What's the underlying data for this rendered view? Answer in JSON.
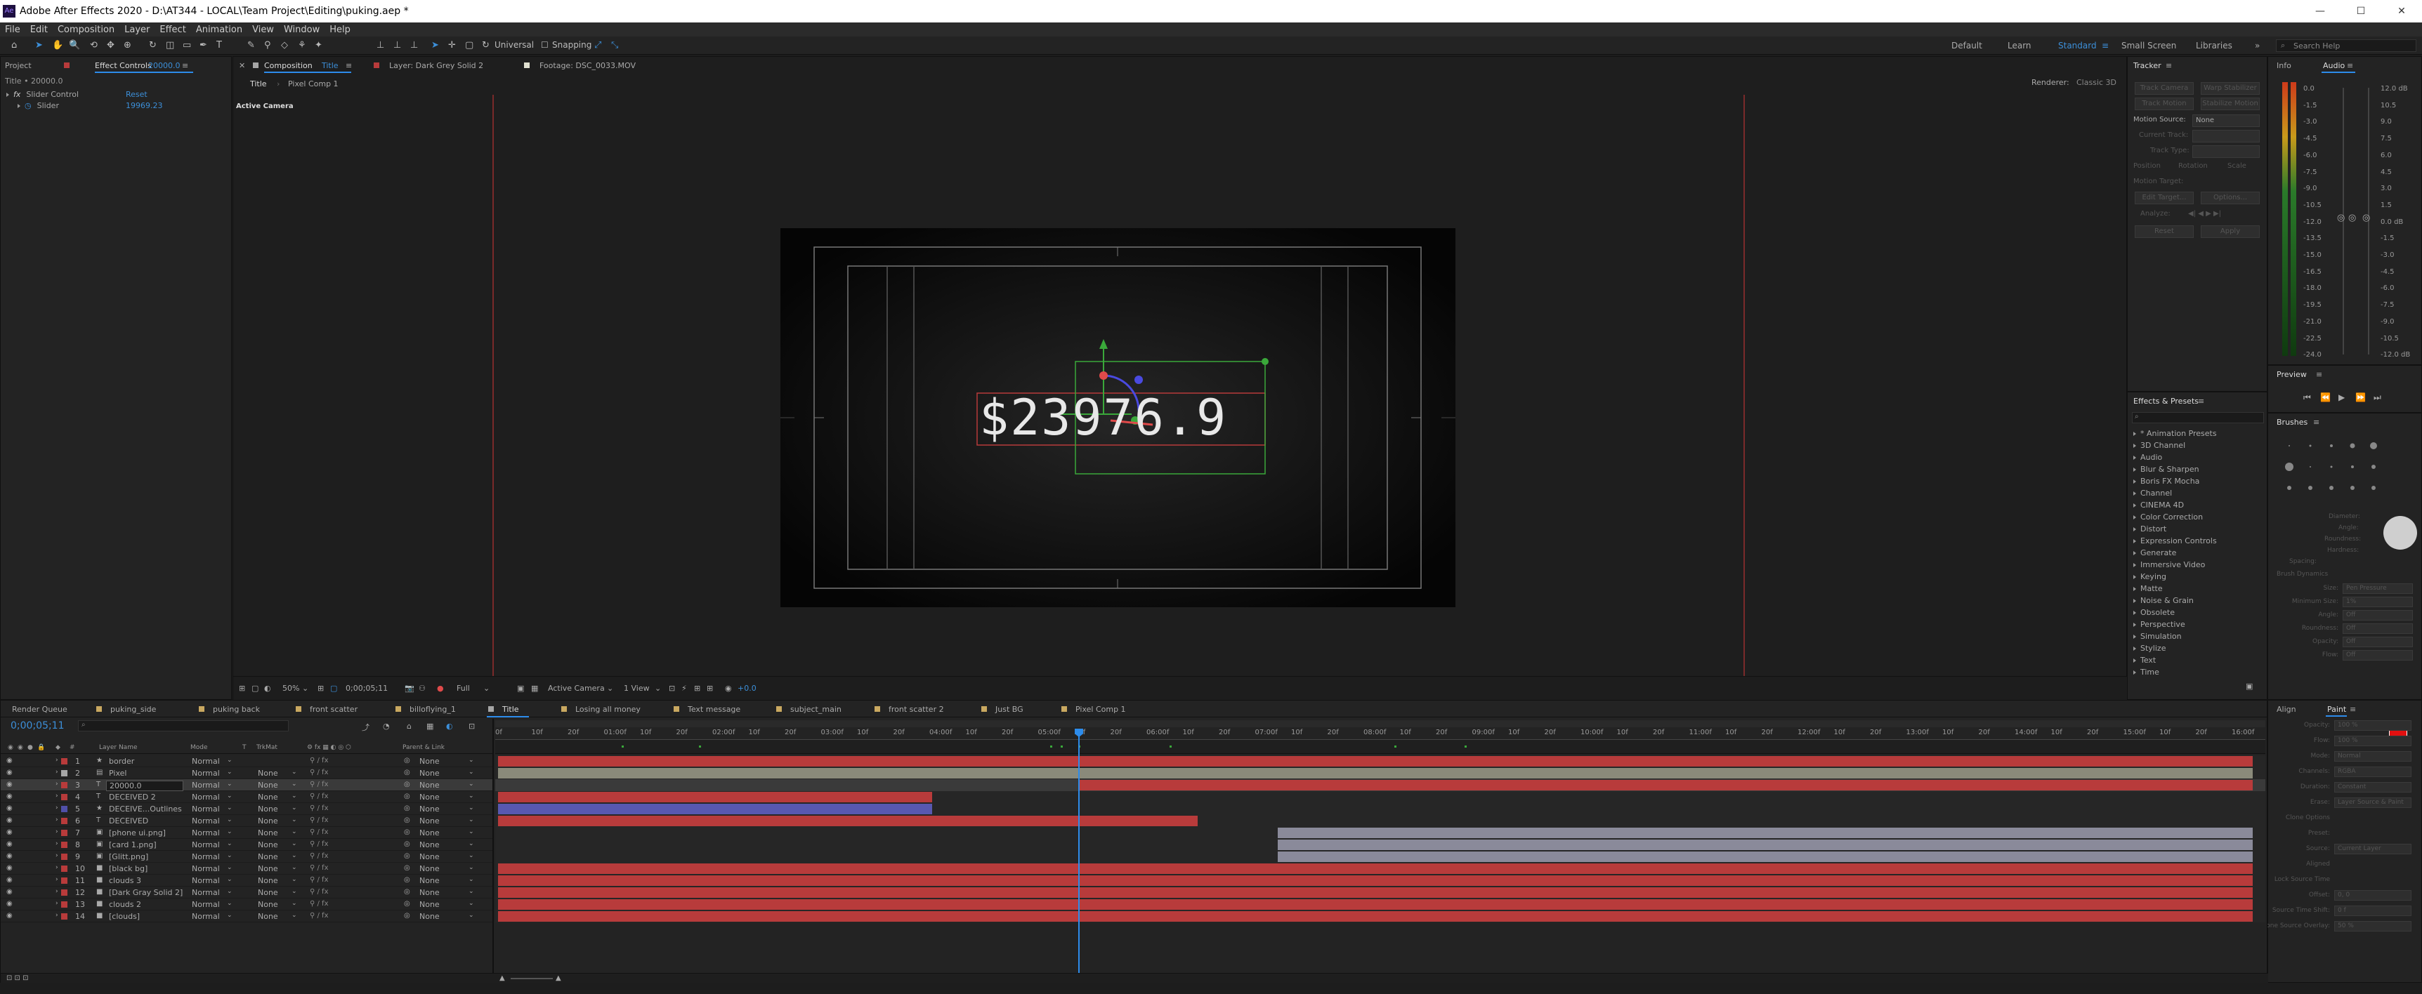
{
  "titlebar": {
    "title": "Adobe After Effects 2020 - D:\\AT344 - LOCAL\\Team Project\\Editing\\puking.aep *"
  },
  "menu": [
    "File",
    "Edit",
    "Composition",
    "Layer",
    "Effect",
    "Animation",
    "View",
    "Window",
    "Help"
  ],
  "toolbar": {
    "universal": "Universal",
    "snapping": "Snapping",
    "workspaces": [
      "Default",
      "Learn",
      "Standard",
      "Small Screen",
      "Libraries"
    ],
    "active_workspace": "Standard",
    "search_placeholder": "Search Help"
  },
  "left_panel": {
    "tab_project": "Project",
    "tab_effect_controls": "Effect Controls",
    "tab_effect_controls_layer": "20000.0",
    "header": "Title • 20000.0",
    "effect_name": "Slider Control",
    "reset": "Reset",
    "param_name": "Slider",
    "param_value": "19969.23"
  },
  "comp_panel": {
    "tab_comp": "Composition",
    "tab_comp_name": "Title",
    "tab_layer": "Layer: Dark Grey Solid 2",
    "tab_footage": "Footage: DSC_0033.MOV",
    "breadcrumb": [
      "Title",
      "Pixel Comp 1"
    ],
    "renderer_label": "Renderer:",
    "renderer_value": "Classic 3D",
    "active_camera": "Active Camera",
    "overlay_text": "$23976.9",
    "footer": {
      "zoom": "50%",
      "timecode": "0;00;05;11",
      "resolution": "Full",
      "view": "Active Camera",
      "views": "1 View",
      "exposure": "+0.0"
    }
  },
  "tracker": {
    "title": "Tracker",
    "motion_source_label": "Motion Source:",
    "motion_source_value": "None",
    "buttons": [
      "Track Camera",
      "Warp Stabilizer",
      "Track Motion",
      "Stabilize Motion"
    ],
    "current_track": "Current Track:",
    "track_type": "Track Type:",
    "options": [
      "Position",
      "Rotation",
      "Scale"
    ],
    "motion_target": "Motion Target:",
    "edit_target": "Edit Target...",
    "options_btn": "Options...",
    "analyze": "Analyze:",
    "reset": "Reset",
    "apply": "Apply"
  },
  "info_audio": {
    "tab_info": "Info",
    "tab_audio": "Audio",
    "db_left": [
      "0.0",
      "-1.5",
      "-3.0",
      "-4.5",
      "-6.0",
      "-7.5",
      "-9.0",
      "-10.5",
      "-12.0",
      "-13.5",
      "-15.0",
      "-16.5",
      "-18.0",
      "-19.5",
      "-21.0",
      "-22.5",
      "-24.0"
    ],
    "db_right": [
      "12.0 dB",
      "10.5",
      "9.0",
      "7.5",
      "6.0",
      "4.5",
      "3.0",
      "1.5",
      "0.0 dB",
      "-1.5",
      "-3.0",
      "-4.5",
      "-6.0",
      "-7.5",
      "-9.0",
      "-10.5",
      "-12.0 dB"
    ]
  },
  "effects_presets": {
    "title": "Effects & Presets",
    "search_placeholder": "",
    "items": [
      "* Animation Presets",
      "3D Channel",
      "Audio",
      "Blur & Sharpen",
      "Boris FX Mocha",
      "Channel",
      "CINEMA 4D",
      "Color Correction",
      "Distort",
      "Expression Controls",
      "Generate",
      "Immersive Video",
      "Keying",
      "Matte",
      "Noise & Grain",
      "Obsolete",
      "Perspective",
      "Simulation",
      "Stylize",
      "Text",
      "Time"
    ]
  },
  "preview": {
    "title": "Preview"
  },
  "brushes": {
    "title": "Brushes",
    "props": [
      "Diameter:",
      "Angle:",
      "Roundness:",
      "Hardness:",
      "Spacing:"
    ],
    "dynamics": "Brush Dynamics",
    "dyn_props": [
      "Size:",
      "Minimum Size:",
      "Angle:",
      "Roundness:",
      "Opacity:",
      "Flow:"
    ],
    "dyn_values": [
      "Pen Pressure",
      "1%",
      "Off",
      "Off",
      "Off",
      "Off"
    ]
  },
  "align_paint": {
    "tab_align": "Align",
    "tab_paint": "Paint",
    "fields": [
      "Opacity:",
      "Flow:",
      "Mode:",
      "Channels:",
      "Duration:",
      "Erase:",
      "Clone Options",
      "Preset:",
      "Source:",
      "Aligned",
      "Lock Source Time",
      "Offset:",
      "Source Time Shift:",
      "Clone Source Overlay:"
    ],
    "values": [
      "100 %",
      "100 %",
      "Normal",
      "RGBA",
      "Constant",
      "Layer Source & Paint",
      "",
      "",
      "Current Layer",
      "",
      "",
      "0, 0",
      "0 f",
      "50 %"
    ]
  },
  "timeline": {
    "tabs": [
      "Render Queue",
      "puking_side",
      "puking back",
      "front scatter",
      "billoflying_1",
      "Title",
      "Losing all money",
      "Text message",
      "subject_main",
      "front scatter 2",
      "Just BG",
      "Pixel Comp 1"
    ],
    "active_tab": "Title",
    "timecode": "0;00;05;11",
    "col_layer": "Layer Name",
    "col_mode": "Mode",
    "col_t": "T",
    "col_trkmat": "TrkMat",
    "col_parent": "Parent & Link",
    "ruler": [
      "0f",
      "10f",
      "20f",
      "01:00f",
      "10f",
      "20f",
      "02:00f",
      "10f",
      "20f",
      "03:00f",
      "10f",
      "20f",
      "04:00f",
      "10f",
      "20f",
      "05:00f",
      "10f",
      "20f",
      "06:00f",
      "10f",
      "20f",
      "07:00f",
      "10f",
      "20f",
      "08:00f",
      "10f",
      "20f",
      "09:00f",
      "10f",
      "20f",
      "10:00f",
      "10f",
      "20f",
      "11:00f",
      "10f",
      "20f",
      "12:00f",
      "10f",
      "20f",
      "13:00f",
      "10f",
      "20f",
      "14:00f",
      "10f",
      "20f",
      "15:00f",
      "10f",
      "20f",
      "16:00f"
    ],
    "layers": [
      {
        "num": "1",
        "name": "border",
        "type": "shape",
        "mode": "Normal",
        "trkmat": "",
        "parent": "None",
        "color": "#b83b3b",
        "bar": "full"
      },
      {
        "num": "2",
        "name": "Pixel",
        "type": "comp",
        "mode": "Normal",
        "trkmat": "None",
        "parent": "None",
        "color": "#a6a6a6",
        "bar": "full_grey"
      },
      {
        "num": "3",
        "name": "20000.0",
        "type": "text",
        "mode": "Normal",
        "trkmat": "None",
        "parent": "None",
        "color": "#b83b3b",
        "bar": "from_playhead"
      },
      {
        "num": "4",
        "name": "DECEIVED 2",
        "type": "text",
        "mode": "Normal",
        "trkmat": "None",
        "parent": "None",
        "color": "#b83b3b",
        "bar": "short_red"
      },
      {
        "num": "5",
        "name": "DECEIVE...Outlines",
        "type": "shape",
        "mode": "Normal",
        "trkmat": "None",
        "parent": "None",
        "color": "#5050a8",
        "bar": "short_blue"
      },
      {
        "num": "6",
        "name": "DECEIVED",
        "type": "text",
        "mode": "Normal",
        "trkmat": "None",
        "parent": "None",
        "color": "#b83b3b",
        "bar": "mid_red"
      },
      {
        "num": "7",
        "name": "[phone ui.png]",
        "type": "footage",
        "mode": "Normal",
        "trkmat": "None",
        "parent": "None",
        "color": "#b83b3b",
        "bar": "late_grey"
      },
      {
        "num": "8",
        "name": "[card 1.png]",
        "type": "footage",
        "mode": "Normal",
        "trkmat": "None",
        "parent": "None",
        "color": "#b83b3b",
        "bar": "late_grey"
      },
      {
        "num": "9",
        "name": "[Glitt.png]",
        "type": "footage",
        "mode": "Normal",
        "trkmat": "None",
        "parent": "None",
        "color": "#b83b3b",
        "bar": "late_grey"
      },
      {
        "num": "10",
        "name": "[black bg]",
        "type": "solid",
        "mode": "Normal",
        "trkmat": "None",
        "parent": "None",
        "color": "#b83b3b",
        "bar": "full"
      },
      {
        "num": "11",
        "name": "clouds 3",
        "type": "solid",
        "mode": "Normal",
        "trkmat": "None",
        "parent": "None",
        "color": "#b83b3b",
        "bar": "full"
      },
      {
        "num": "12",
        "name": "[Dark Gray Solid 2]",
        "type": "solid",
        "mode": "Normal",
        "trkmat": "None",
        "parent": "None",
        "color": "#b83b3b",
        "bar": "full"
      },
      {
        "num": "13",
        "name": "clouds 2",
        "type": "solid",
        "mode": "Normal",
        "trkmat": "None",
        "parent": "None",
        "color": "#b83b3b",
        "bar": "full"
      },
      {
        "num": "14",
        "name": "[clouds]",
        "type": "solid",
        "mode": "Normal",
        "trkmat": "None",
        "parent": "None",
        "color": "#b83b3b",
        "bar": "full"
      }
    ]
  }
}
